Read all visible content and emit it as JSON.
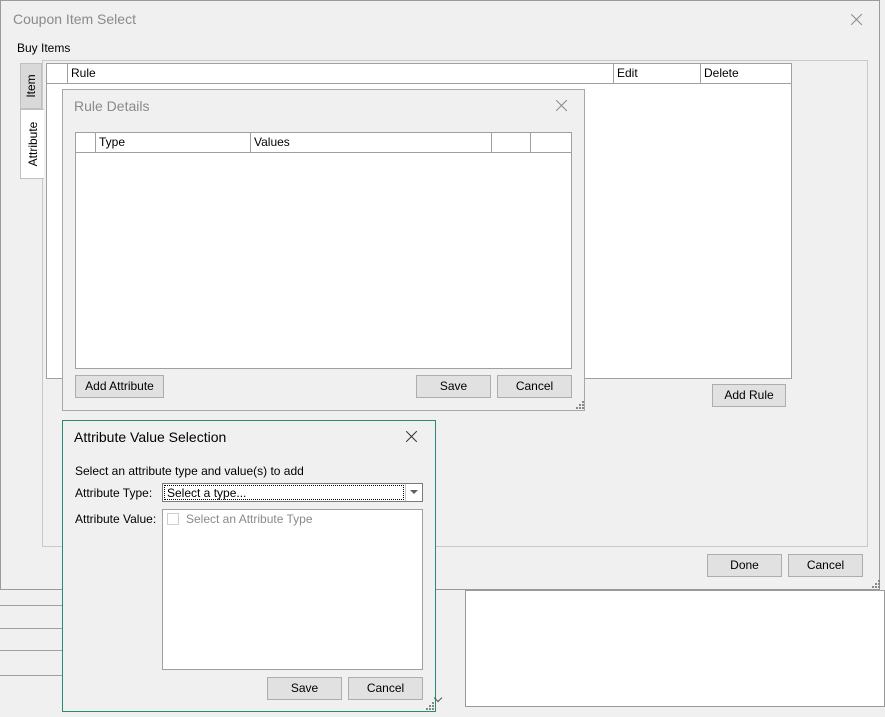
{
  "main": {
    "title": "Coupon Item Select",
    "section_label": "Buy Items",
    "tabs": [
      {
        "label": "Item"
      },
      {
        "label": "Attribute"
      }
    ],
    "grid": {
      "columns": [
        "Rule",
        "Edit",
        "Delete"
      ]
    },
    "add_rule_label": "Add Rule",
    "done_label": "Done",
    "cancel_label": "Cancel"
  },
  "rule_details": {
    "title": "Rule Details",
    "grid": {
      "columns": [
        "Type",
        "Values",
        "",
        ""
      ]
    },
    "add_attribute_label": "Add Attribute",
    "save_label": "Save",
    "cancel_label": "Cancel"
  },
  "attr_dialog": {
    "title": "Attribute Value Selection",
    "instruction": "Select an attribute type and value(s) to add",
    "type_label": "Attribute Type:",
    "type_value": "Select a type...",
    "value_label": "Attribute Value:",
    "value_placeholder": "Select an Attribute Type",
    "save_label": "Save",
    "cancel_label": "Cancel"
  },
  "colors": {
    "accent_border": "#2a8a78",
    "window_bg": "#f0f0f0"
  }
}
